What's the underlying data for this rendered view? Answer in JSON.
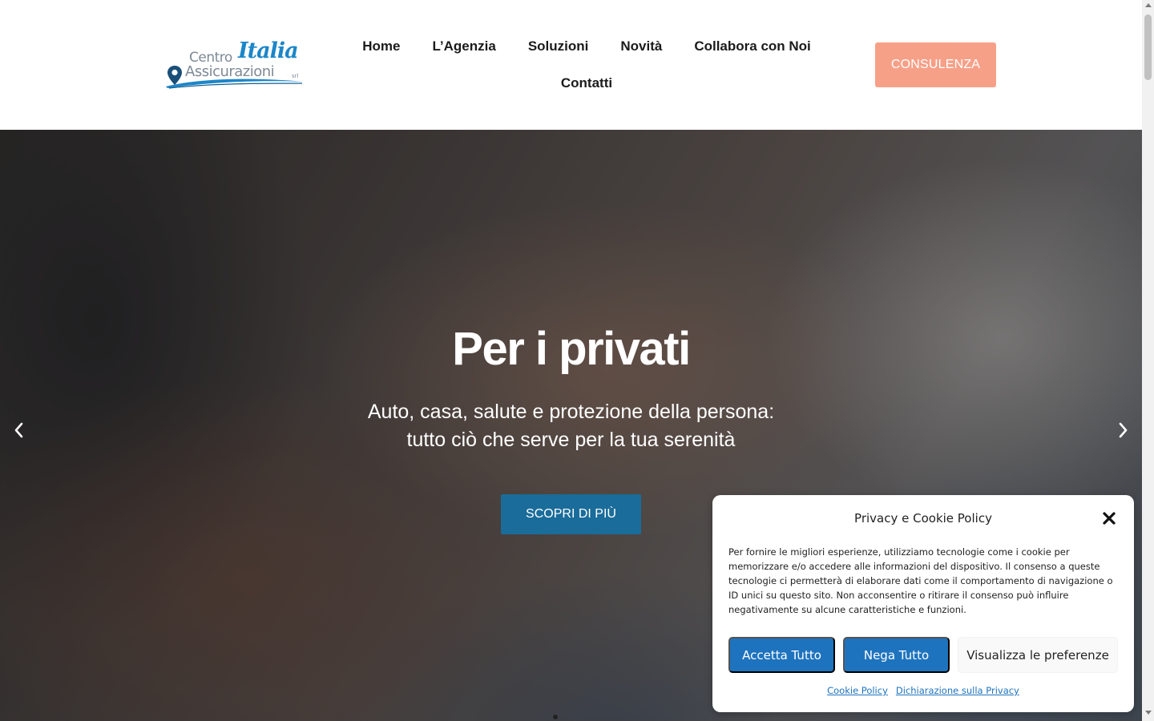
{
  "logo": {
    "word_centro": "Centro",
    "word_italia": "Italia",
    "word_assicurazioni": "Assicurazioni",
    "word_srl": "srl"
  },
  "nav": {
    "items": [
      "Home",
      "L’Agenzia",
      "Soluzioni",
      "Novità",
      "Collabora con Noi",
      "Contatti"
    ]
  },
  "header": {
    "cta_label": "CONSULENZA"
  },
  "hero": {
    "title": "Per i privati",
    "subtitle_line1": "Auto, casa, salute e protezione della persona:",
    "subtitle_line2": "tutto ciò che serve per la tua serenità",
    "cta_label": "SCOPRI DI PIÙ",
    "slides_count": 1
  },
  "cookie": {
    "title": "Privacy e Cookie Policy",
    "body": "Per fornire le migliori esperienze, utilizziamo tecnologie come i cookie per memorizzare e/o accedere alle informazioni del dispositivo. Il consenso a queste tecnologie ci permetterà di elaborare dati come il comportamento di navigazione o ID unici su questo sito. Non acconsentire o ritirare il consenso può influire negativamente su alcune caratteristiche e funzioni.",
    "accept_label": "Accetta Tutto",
    "deny_label": "Nega Tutto",
    "prefs_label": "Visualizza le preferenze",
    "link_cookie_policy": "Cookie Policy",
    "link_privacy": "Dichiarazione sulla Privacy"
  },
  "colors": {
    "cta_consulenza": "#f7a088",
    "cta_scopri": "#1a6c9a",
    "cookie_primary": "#1e73be",
    "logo_blue": "#1c86c8"
  },
  "icons": {
    "logo_pin": "map-pin-icon",
    "close": "close-icon",
    "prev": "chevron-left-icon",
    "next": "chevron-right-icon"
  }
}
